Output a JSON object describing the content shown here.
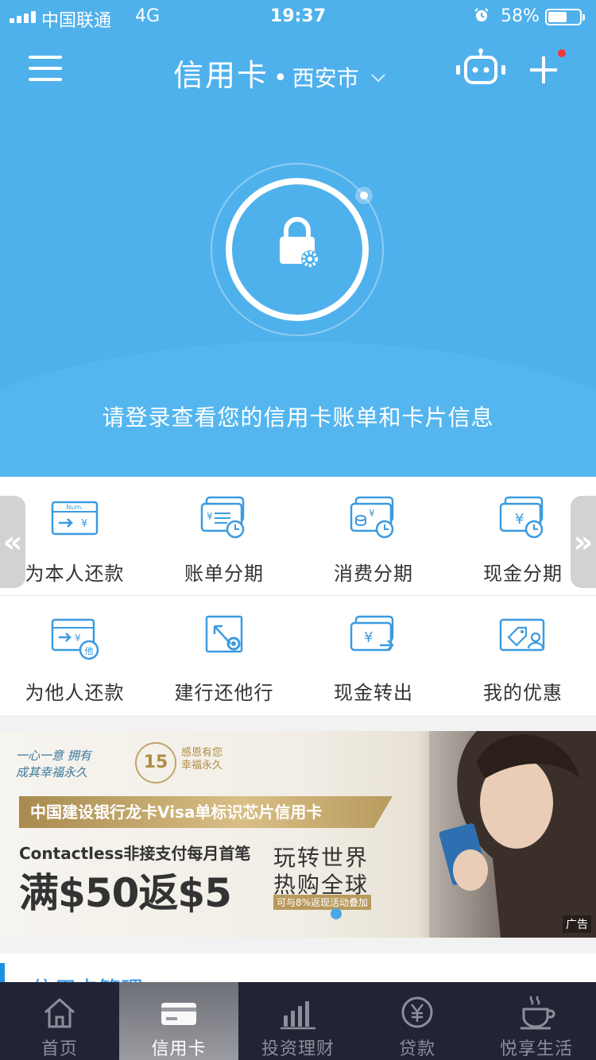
{
  "status_bar": {
    "carrier": "中国联通",
    "network": "4G",
    "time": "19:37",
    "battery": "58%"
  },
  "header": {
    "title": "信用卡",
    "dot": "•",
    "city": "西安市"
  },
  "login": {
    "hint": "请登录查看您的信用卡账单和卡片信息"
  },
  "actions": {
    "row1": [
      {
        "label": "为本人还款",
        "icon": "repay-self-icon"
      },
      {
        "label": "账单分期",
        "icon": "bill-installment-icon"
      },
      {
        "label": "消费分期",
        "icon": "consumer-installment-icon"
      },
      {
        "label": "现金分期",
        "icon": "cash-installment-icon"
      }
    ],
    "row2": [
      {
        "label": "为他人还款",
        "icon": "repay-others-icon"
      },
      {
        "label": "建行还他行",
        "icon": "repay-other-bank-icon"
      },
      {
        "label": "现金转出",
        "icon": "cash-transfer-icon"
      },
      {
        "label": "我的优惠",
        "icon": "my-offers-icon"
      }
    ],
    "left_arrow": "«",
    "right_arrow": "»"
  },
  "banner": {
    "brand_line1": "一心一意 拥有",
    "brand_line2": "成其幸福永久",
    "badge": "15",
    "thanks_line1": "感恩有您",
    "thanks_line2": "幸福永久",
    "ribbon": "中国建设银行龙卡Visa单标识芯片信用卡",
    "contactless": "Contactless非接支付每月首笔",
    "offer": "满$50返$5",
    "slogan1": "玩转世界",
    "slogan2": "热购全球",
    "tag": "可与8%返现活动叠加",
    "ad_label": "广告"
  },
  "section": {
    "title": "信用卡管理"
  },
  "tabbar": {
    "tabs": [
      {
        "label": "首页",
        "icon": "home-icon"
      },
      {
        "label": "信用卡",
        "icon": "credit-card-icon"
      },
      {
        "label": "投资理财",
        "icon": "investment-chart-icon"
      },
      {
        "label": "贷款",
        "icon": "loan-yen-icon"
      },
      {
        "label": "悦享生活",
        "icon": "coffee-cup-icon"
      }
    ],
    "active_index": 1
  },
  "colors": {
    "primary_blue": "#4fb1ec",
    "icon_blue": "#3b9be0",
    "tabbar_bg": "#202435",
    "notification_red": "#f23a3a"
  }
}
